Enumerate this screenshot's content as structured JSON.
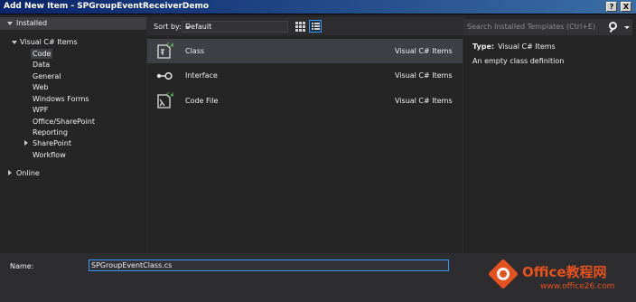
{
  "window": {
    "title": "Add New Item - SPGroupEventReceiverDemo",
    "help_button": "?",
    "close_button": "X"
  },
  "left_pane": {
    "installed_label": "Installed",
    "tree": [
      {
        "label": "Visual C# Items"
      },
      {
        "label": "Code"
      },
      {
        "label": "Data"
      },
      {
        "label": "General"
      },
      {
        "label": "Web"
      },
      {
        "label": "Windows Forms"
      },
      {
        "label": "WPF"
      },
      {
        "label": "Office/SharePoint"
      },
      {
        "label": "Reporting"
      },
      {
        "label": "SharePoint"
      },
      {
        "label": "Workflow"
      }
    ],
    "online_label": "Online",
    "selected": "Code"
  },
  "center_pane": {
    "sort_label": "Sort by:",
    "sort_value": "Default",
    "items": [
      {
        "name": "Class",
        "lang": "Visual C# Items",
        "icon": "class-icon",
        "selected": true
      },
      {
        "name": "Interface",
        "lang": "Visual C# Items",
        "icon": "interface-icon",
        "selected": false
      },
      {
        "name": "Code File",
        "lang": "Visual C# Items",
        "icon": "code-file-icon",
        "selected": false
      }
    ]
  },
  "right_pane": {
    "search_placeholder": "Search Installed Templates (Ctrl+E)",
    "type_label": "Type:",
    "type_value": "Visual C# Items",
    "description": "An empty class definition"
  },
  "bottom": {
    "name_label": "Name:",
    "name_value": "SPGroupEventClass.cs"
  },
  "watermark": {
    "brand": "Office教程网",
    "site": "www.office26.com"
  },
  "colors": {
    "background": "#2d2d30",
    "pane": "#252526",
    "selected": "#3f3f46",
    "accent": "#3399ff",
    "watermark": "#e6521f"
  }
}
